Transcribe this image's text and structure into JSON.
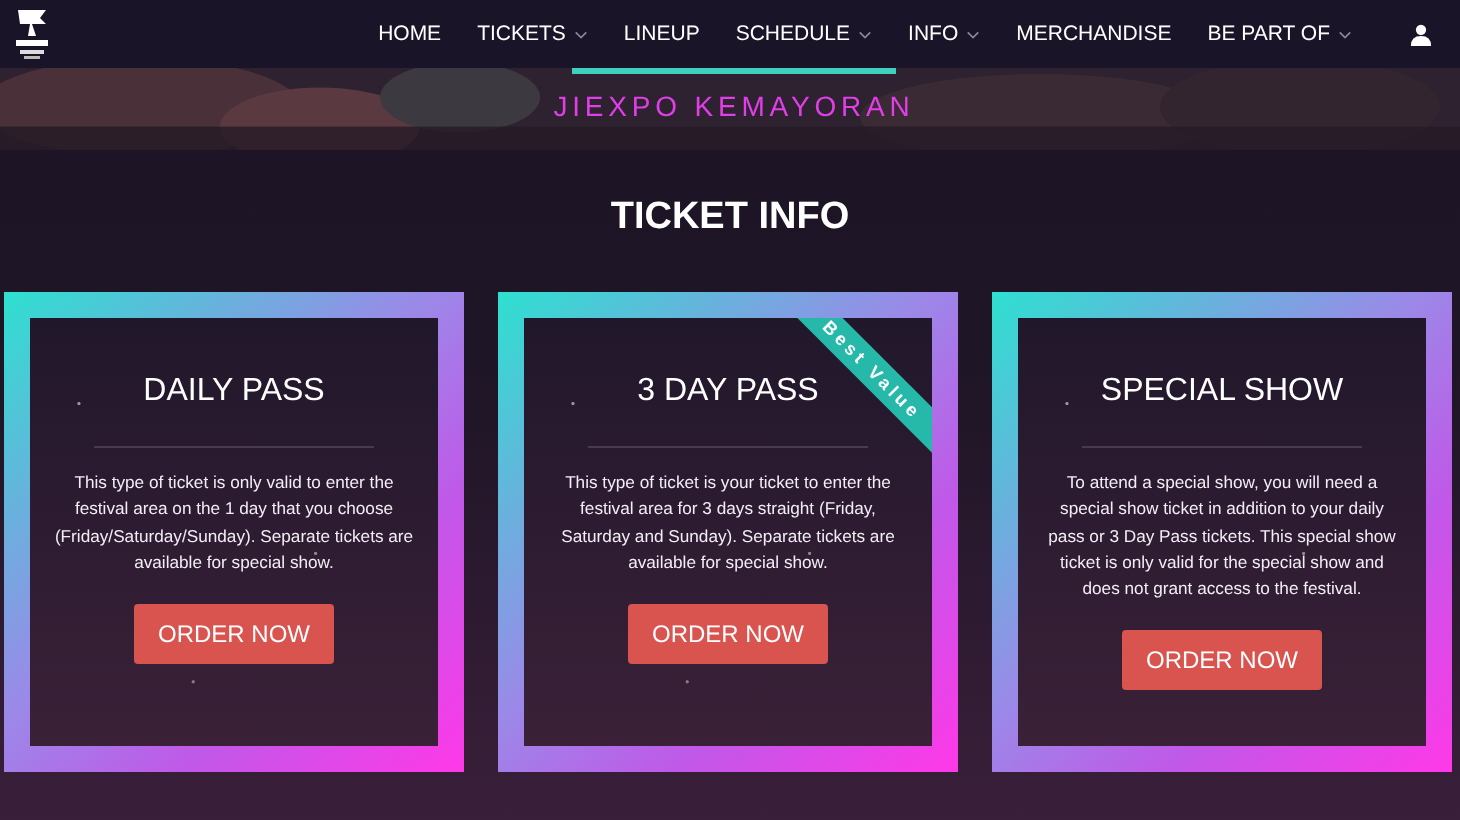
{
  "nav": {
    "items": [
      {
        "label": "HOME",
        "has_menu": false
      },
      {
        "label": "TICKETS",
        "has_menu": true
      },
      {
        "label": "LINEUP",
        "has_menu": false
      },
      {
        "label": "SCHEDULE",
        "has_menu": true
      },
      {
        "label": "INFO",
        "has_menu": true
      },
      {
        "label": "MERCHANDISE",
        "has_menu": false
      },
      {
        "label": "BE PART OF",
        "has_menu": true
      }
    ]
  },
  "hero": {
    "venue": "JIEXPO KEMAYORAN"
  },
  "section_title": "TICKET INFO",
  "tickets": [
    {
      "title": "DAILY PASS",
      "description": "This type of ticket is only valid to enter the festival area on the 1 day that you choose (Friday/Saturday/Sunday). Separate tickets are available for special show.",
      "button": "ORDER NOW"
    },
    {
      "title": "3 DAY PASS",
      "ribbon": "Best Value",
      "description": "This type of ticket is your ticket to enter the festival area for 3 days straight (Friday, Saturday and Sunday). Separate tickets are available for special show.",
      "button": "ORDER NOW"
    },
    {
      "title": "SPECIAL SHOW",
      "description": "To attend a special show, you will need a special show ticket in addition to your daily pass or 3 Day Pass tickets. This special show ticket is only valid for the special show and does not grant access to the festival.",
      "button": "ORDER NOW"
    }
  ]
}
